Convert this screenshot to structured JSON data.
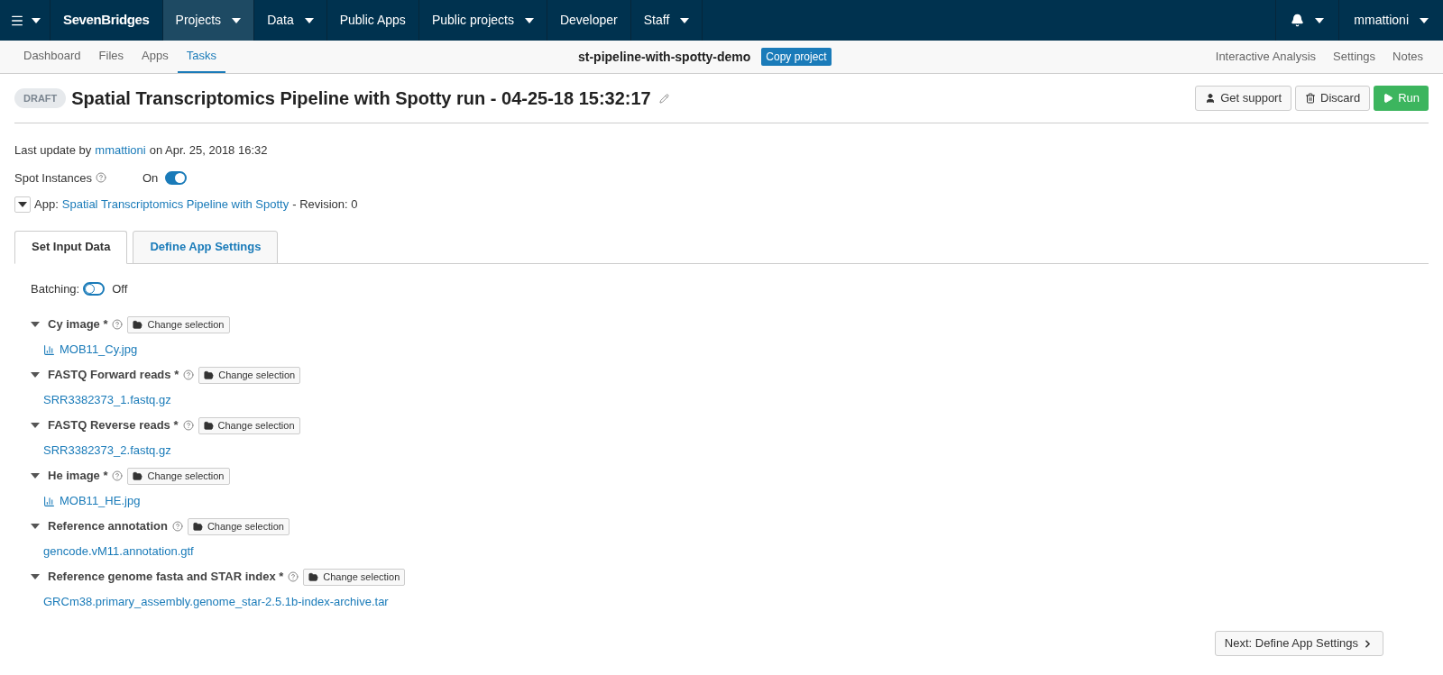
{
  "topnav": {
    "brand": "SevenBridges",
    "items": [
      {
        "label": "Projects",
        "caret": true,
        "selected": true
      },
      {
        "label": "Data",
        "caret": true,
        "selected": false
      },
      {
        "label": "Public Apps",
        "caret": false,
        "selected": false
      },
      {
        "label": "Public projects",
        "caret": true,
        "selected": false
      },
      {
        "label": "Developer",
        "caret": false,
        "selected": false
      },
      {
        "label": "Staff",
        "caret": true,
        "selected": false
      }
    ],
    "user": "mmattioni"
  },
  "subnav": {
    "tabs": [
      {
        "label": "Dashboard",
        "selected": false
      },
      {
        "label": "Files",
        "selected": false
      },
      {
        "label": "Apps",
        "selected": false
      },
      {
        "label": "Tasks",
        "selected": true
      }
    ],
    "project": "st-pipeline-with-spotty-demo",
    "copy_button": "Copy project",
    "right_links": [
      "Interactive Analysis",
      "Settings",
      "Notes"
    ]
  },
  "task": {
    "status": "DRAFT",
    "title": "Spatial Transcriptomics Pipeline with Spotty run - 04-25-18 15:32:17",
    "buttons": {
      "support": "Get support",
      "discard": "Discard",
      "run": "Run"
    },
    "last_update": {
      "prefix": "Last update by",
      "user": "mmattioni",
      "suffix": "on Apr. 25, 2018 16:32"
    },
    "spot": {
      "label": "Spot Instances",
      "state": "On",
      "on": true
    },
    "app": {
      "label": "App:",
      "name": "Spatial Transcriptomics Pipeline with Spotty",
      "revision": "- Revision: 0"
    }
  },
  "tabs": [
    {
      "label": "Set Input Data",
      "selected": true
    },
    {
      "label": "Define App Settings",
      "selected": false
    }
  ],
  "batching": {
    "label": "Batching:",
    "state": "Off",
    "on": false
  },
  "inputs": [
    {
      "label": "Cy image *",
      "button": "Change selection",
      "file": "MOB11_Cy.jpg",
      "kind": "image"
    },
    {
      "label": "FASTQ Forward reads *",
      "button": "Change selection",
      "file": "SRR3382373_1.fastq.gz",
      "kind": "file"
    },
    {
      "label": "FASTQ Reverse reads *",
      "button": "Change selection",
      "file": "SRR3382373_2.fastq.gz",
      "kind": "file"
    },
    {
      "label": "He image *",
      "button": "Change selection",
      "file": "MOB11_HE.jpg",
      "kind": "image"
    },
    {
      "label": "Reference annotation",
      "button": "Change selection",
      "file": "gencode.vM11.annotation.gtf",
      "kind": "file"
    },
    {
      "label": "Reference genome fasta and STAR index *",
      "button": "Change selection",
      "file": "GRCm38.primary_assembly.genome_star-2.5.1b-index-archive.tar",
      "kind": "file"
    }
  ],
  "next_button": "Next: Define App Settings"
}
